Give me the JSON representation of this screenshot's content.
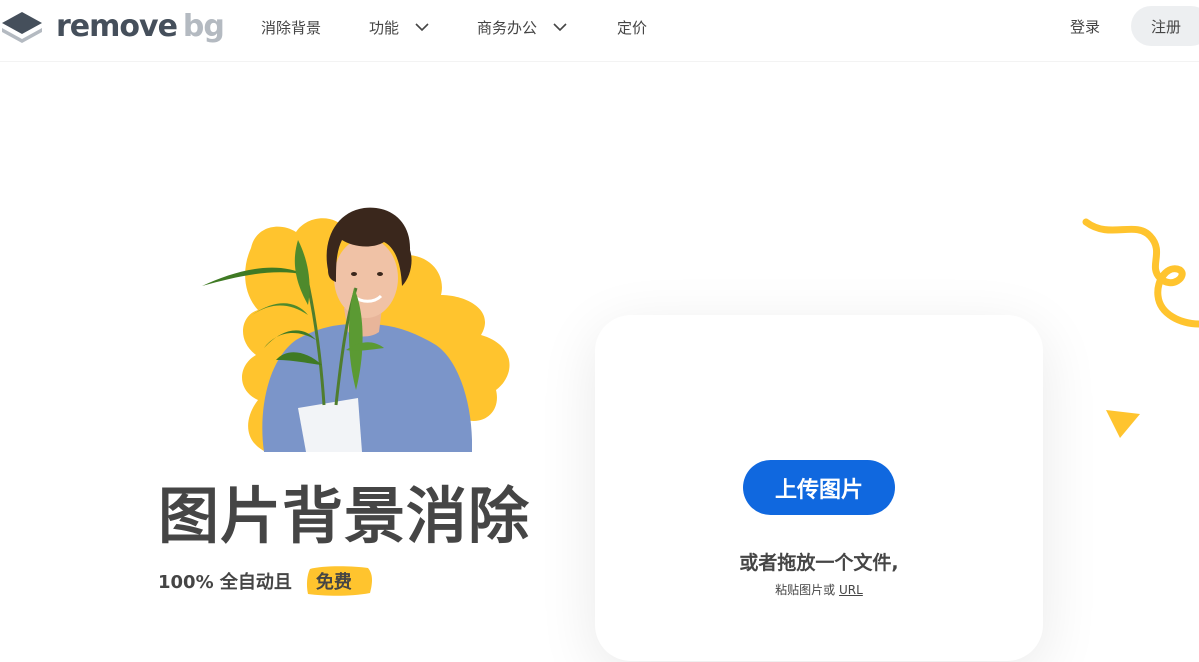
{
  "header": {
    "logo": {
      "word1": "remove",
      "word2": "bg"
    },
    "nav": [
      {
        "label": "消除背景",
        "has_dropdown": false
      },
      {
        "label": "功能",
        "has_dropdown": true
      },
      {
        "label": "商务办公",
        "has_dropdown": true
      },
      {
        "label": "定价",
        "has_dropdown": false
      }
    ],
    "login_label": "登录",
    "signup_label": "注册"
  },
  "hero": {
    "title": "图片背景消除",
    "subtitle_prefix": "100% 全自动且",
    "subtitle_badge": "免费"
  },
  "upload_card": {
    "button_label": "上传图片",
    "drop_text": "或者拖放一个文件,",
    "paste_text": "粘贴图片或",
    "url_link": "URL"
  },
  "colors": {
    "primary": "#1068df",
    "accent_yellow": "#ffc42e",
    "text": "#454545",
    "logo_dark": "#454f5b",
    "logo_light": "#b4bac1"
  }
}
